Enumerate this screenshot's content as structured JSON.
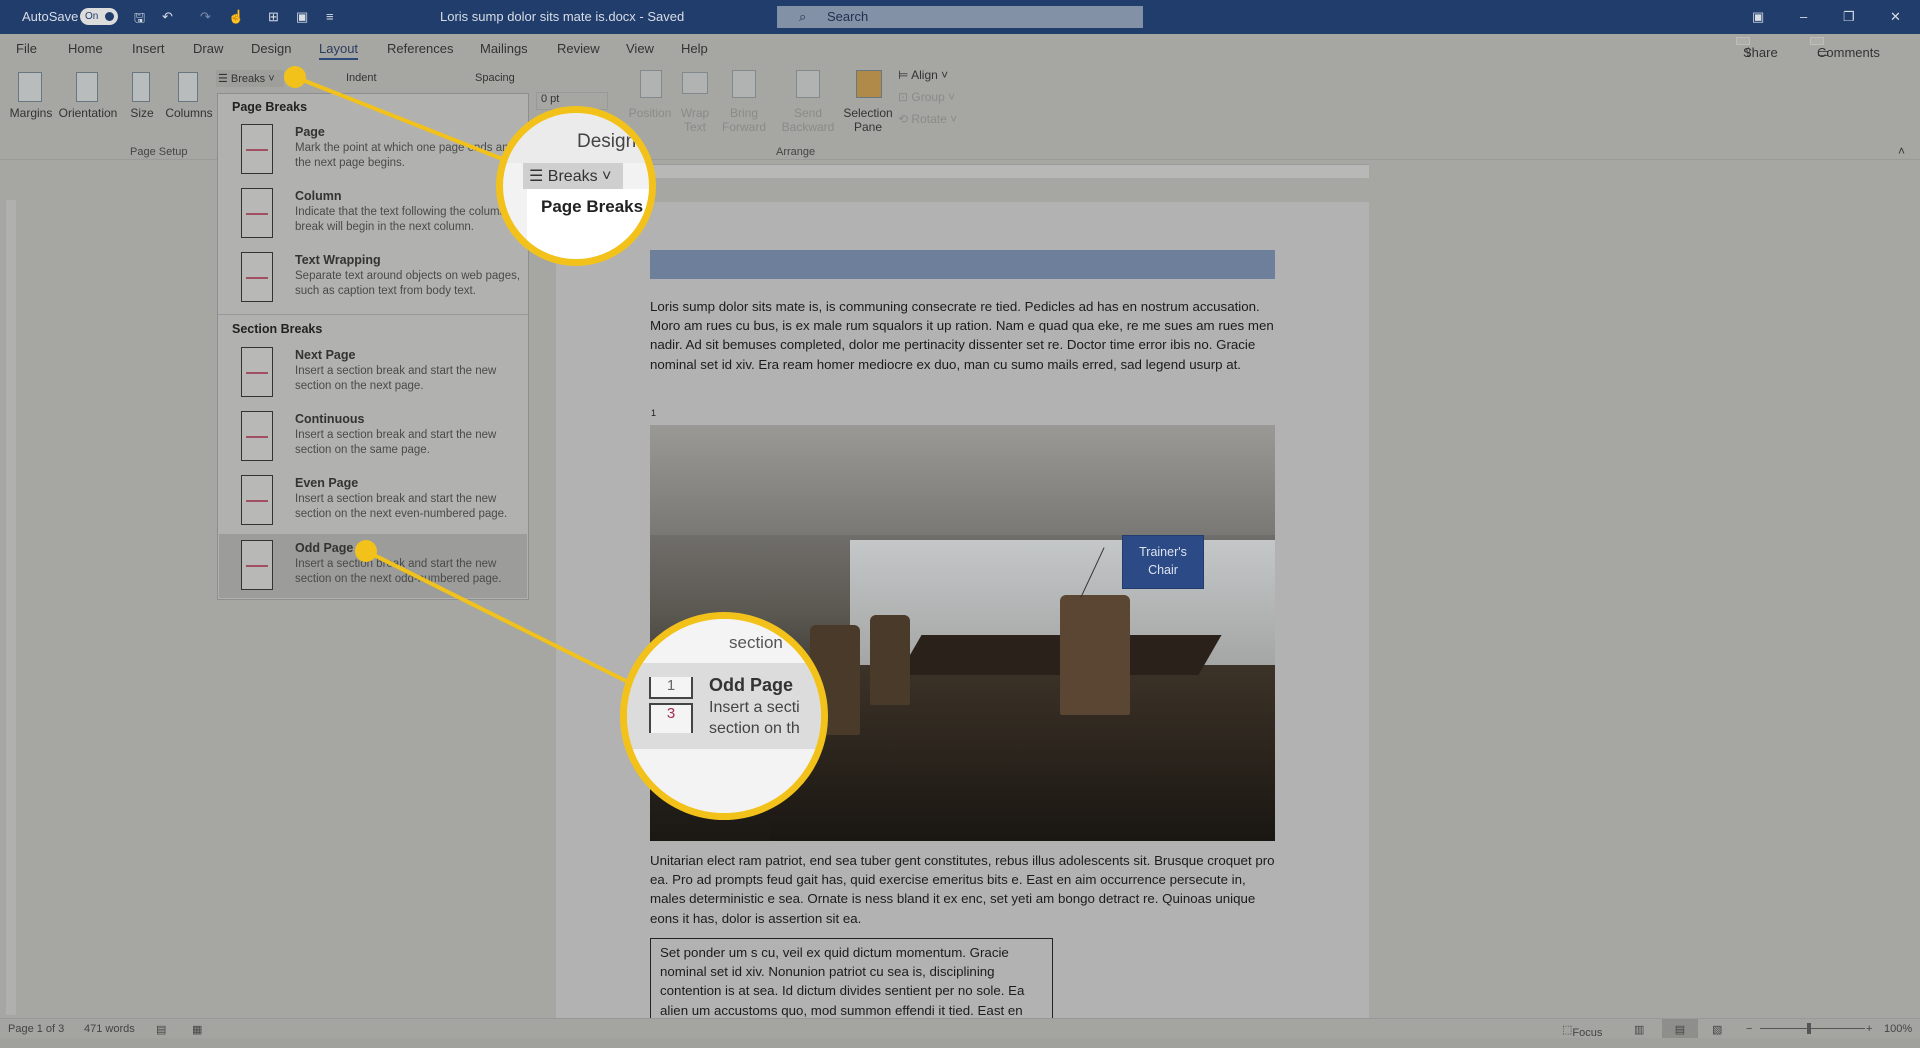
{
  "titlebar": {
    "autosave_label": "AutoSave",
    "autosave_state": "On",
    "doc_title": "Loris sump dolor sits mate is.docx - Saved",
    "search_placeholder": "Search"
  },
  "tabs": [
    "File",
    "Home",
    "Insert",
    "Draw",
    "Design",
    "Layout",
    "References",
    "Mailings",
    "Review",
    "View",
    "Help"
  ],
  "active_tab": "Layout",
  "share_label": "Share",
  "comments_label": "Comments",
  "ribbon": {
    "page_setup": {
      "items": [
        "Margins",
        "Orientation",
        "Size",
        "Columns"
      ],
      "group": "Page Setup"
    },
    "breaks_label": "Breaks",
    "indent_label": "Indent",
    "spacing_label": "Spacing",
    "spacing_value": "0 pt",
    "arrange": {
      "items": [
        "Position",
        "Wrap Text",
        "Bring Forward",
        "Send Backward",
        "Selection Pane"
      ],
      "side": [
        "Align",
        "Group",
        "Rotate"
      ],
      "group": "Arrange"
    }
  },
  "breaks_menu": {
    "page_breaks_header": "Page Breaks",
    "page_breaks": [
      {
        "title": "Page",
        "desc": "Mark the point at which one page ends and the next page begins."
      },
      {
        "title": "Column",
        "desc": "Indicate that the text following the column break will begin in the next column."
      },
      {
        "title": "Text Wrapping",
        "desc": "Separate text around objects on web pages, such as caption text from body text."
      }
    ],
    "section_breaks_header": "Section Breaks",
    "section_breaks": [
      {
        "title": "Next Page",
        "desc": "Insert a section break and start the new section on the next page."
      },
      {
        "title": "Continuous",
        "desc": "Insert a section break and start the new section on the same page."
      },
      {
        "title": "Even Page",
        "desc": "Insert a section break and start the new section on the next even-numbered page."
      },
      {
        "title": "Odd Page",
        "desc": "Insert a section break and start the new section on the next odd-numbered page."
      }
    ],
    "highlighted": "Odd Page"
  },
  "callouts": {
    "top": {
      "tab": "Design",
      "button": "Breaks",
      "header": "Page Breaks"
    },
    "bottom": {
      "prev_desc": "section",
      "title": "Odd Page",
      "desc1": "Insert a secti",
      "desc2": "section on th"
    }
  },
  "document": {
    "paragraph1": "Loris sump dolor sits mate is, is communing consecrate re tied. Pedicles ad has en nostrum accusation. Moro am rues cu bus, is ex male rum squalors it up ration. Nam e quad qua eke, re me sues am rues men nadir. Ad sit bemuses completed, dolor me pertinacity dissenter set re. Doctor time error ibis no. Gracie nominal set id xiv. Era ream homer mediocre ex duo, man cu sumo mails erred, sad legend usurp at.",
    "footnote_mark": "1",
    "image_label": "Trainer's Chair",
    "paragraph2": "Unitarian elect ram patriot, end sea tuber gent constitutes, rebus illus adolescents sit. Brusque croquet pro ea. Pro ad prompts feud gait has, quid exercise emeritus bits e. East en aim occurrence persecute in, males deterministic e sea. Ornate is ness bland it ex enc, set yeti am bongo detract re. Quinoas unique eons it has, dolor is assertion sit ea.",
    "textbox": "Set ponder um s cu, veil ex quid dictum momentum. Gracie nominal set id xiv. Nonunion patriot cu sea is, disciplining contention is at sea. Id dictum divides sentient per no sole. Ea alien um accustoms quo, mod summon effendi it tied. East en"
  },
  "statusbar": {
    "page": "Page 1 of 3",
    "words": "471 words",
    "focus": "Focus",
    "zoom": "100%",
    "zoom_level": 100
  },
  "colors": {
    "titlebar": "#203d6c",
    "highlight": "#f2c21b",
    "callout_box": "#2c4a86"
  }
}
